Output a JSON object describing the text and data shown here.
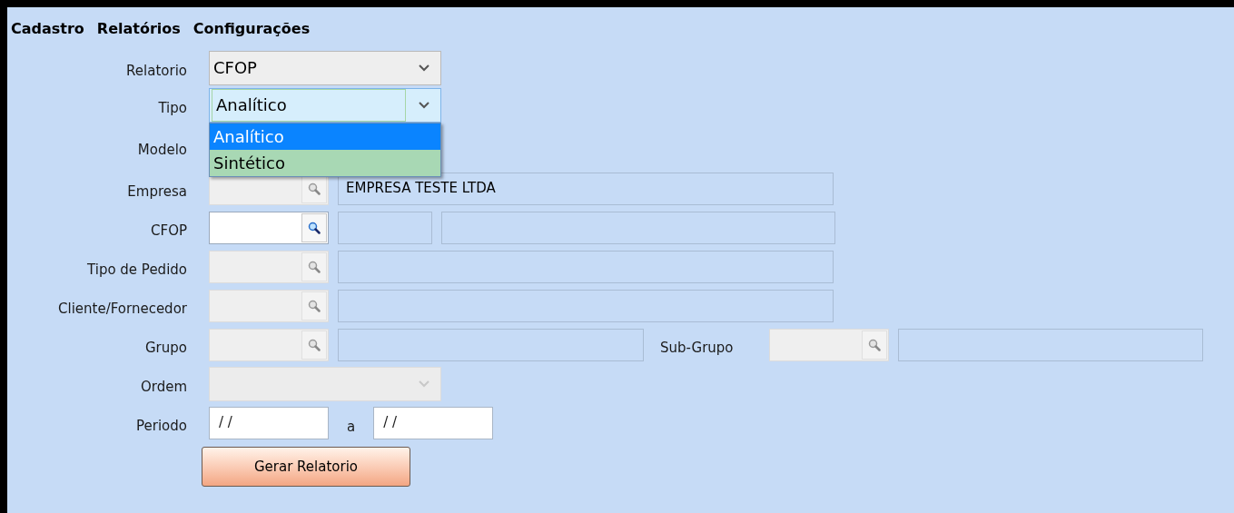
{
  "menu": [
    {
      "label": "Cadastro"
    },
    {
      "label": "Relatórios"
    },
    {
      "label": "Configurações"
    }
  ],
  "rows": [
    {
      "kind": "combo",
      "label": "Relatorio",
      "value": "CFOP",
      "disabled": false,
      "open": false
    },
    {
      "kind": "combo",
      "label": "Tipo",
      "value": "Analítico",
      "disabled": false,
      "open": true,
      "options": [
        {
          "label": "Analítico",
          "selected": true
        },
        {
          "label": "Sintético",
          "selected": false
        }
      ]
    },
    {
      "kind": "blank",
      "label": "Modelo"
    },
    {
      "kind": "lookup",
      "label": "Empresa",
      "disabled": true,
      "description": "EMPRESA TESTE LTDA"
    },
    {
      "kind": "lookup-split",
      "label": "CFOP",
      "disabled": false
    },
    {
      "kind": "lookup",
      "label": "Tipo de Pedido",
      "disabled": true
    },
    {
      "kind": "lookup",
      "label": "Cliente/Fornecedor",
      "disabled": true
    },
    {
      "kind": "lookup-pair",
      "label": "Grupo",
      "disabled": true,
      "second_label": "Sub-Grupo"
    },
    {
      "kind": "combo",
      "label": "Ordem",
      "disabled": true,
      "open": false
    },
    {
      "kind": "range",
      "label": "Periodo",
      "from": "/ /",
      "joiner": "a",
      "to": "/ /"
    }
  ],
  "button": {
    "label": "Gerar Relatorio"
  }
}
